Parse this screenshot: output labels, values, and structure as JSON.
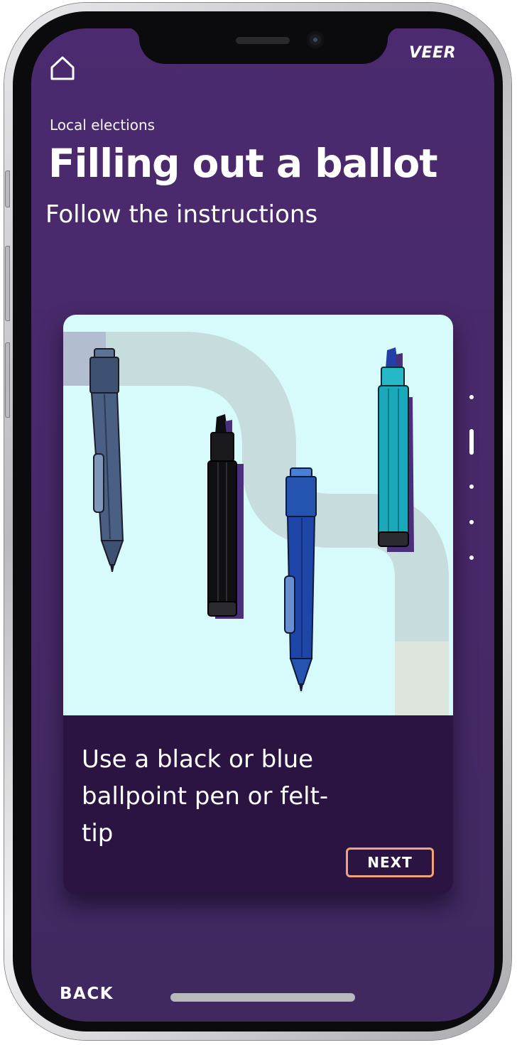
{
  "app": {
    "brand": "VEER"
  },
  "header": {
    "eyebrow": "Local elections",
    "title": "Filling out a ballot",
    "subtitle": "Follow the instructions"
  },
  "card": {
    "illustration_icon": "pens-illustration",
    "text": "Use a black or blue ballpoint pen or felt-tip",
    "next_label": "NEXT"
  },
  "pagination": {
    "total": 5,
    "current": 2
  },
  "footer": {
    "back_label": "BACK"
  },
  "colors": {
    "screen_background": "#4b2a6f",
    "card_text_background": "#2b1442",
    "illustration_background": "#d7fbfb",
    "next_button_border": "#f0a27a",
    "text": "#ffffff"
  },
  "icons": {
    "home": "home-icon"
  }
}
